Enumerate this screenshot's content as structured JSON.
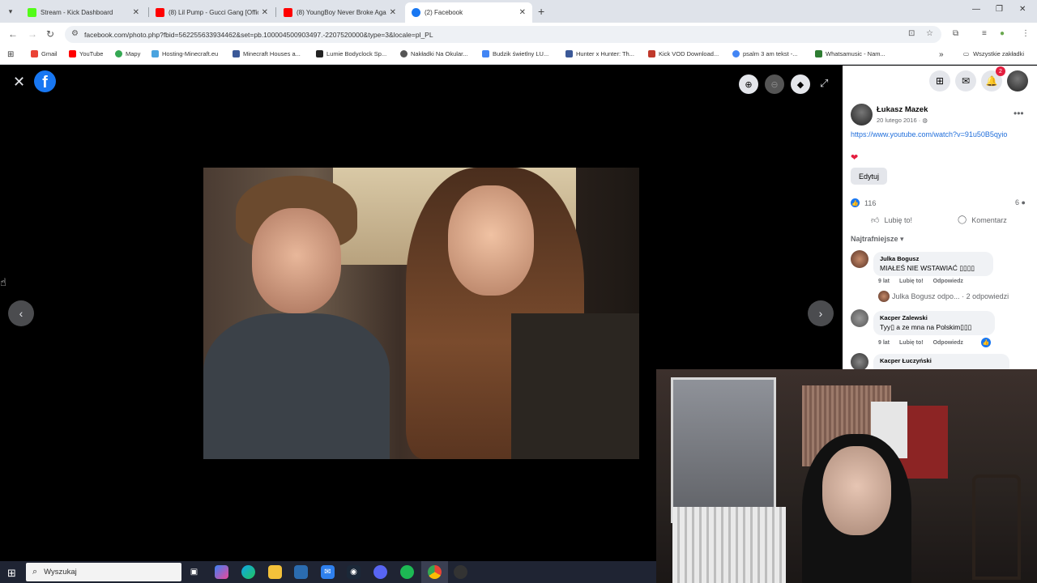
{
  "browser": {
    "tabs": [
      {
        "title": "Stream - Kick Dashboard",
        "color": "#53fc18"
      },
      {
        "title": "(8) Lil Pump - Gucci Gang [Offic",
        "color": "#ff0000"
      },
      {
        "title": "(8) YoungBoy Never Broke Aga",
        "color": "#ff0000"
      },
      {
        "title": "(2) Facebook",
        "color": "#1877f2"
      }
    ],
    "url": "facebook.com/photo.php?fbid=562255633934462&set=pb.100004500903497.-2207520000&type=3&locale=pl_PL",
    "bookmarks": [
      {
        "label": "Gmail",
        "color": "#ea4335"
      },
      {
        "label": "YouTube",
        "color": "#ff0000"
      },
      {
        "label": "Mapy",
        "color": "#34a853"
      },
      {
        "label": "Hosting-Minecraft.eu",
        "color": "#4aa3df"
      },
      {
        "label": "Minecraft Houses a...",
        "color": "#3b5998"
      },
      {
        "label": "Lumie Bodyclock Sp...",
        "color": "#222222"
      },
      {
        "label": "Nakładki Na Okular...",
        "color": "#555555"
      },
      {
        "label": "Budzik świetlny LU...",
        "color": "#4285f4"
      },
      {
        "label": "Hunter x Hunter: Th...",
        "color": "#3b5998"
      },
      {
        "label": "Kick VOD Download...",
        "color": "#c0392b"
      },
      {
        "label": "psalm 3 am tekst -...",
        "color": "#4285f4"
      },
      {
        "label": "Whatsamusic - Nam...",
        "color": "#2e7d32"
      }
    ],
    "all_bookmarks": "Wszystkie zakładki"
  },
  "post": {
    "author": "Łukasz Mazek",
    "date": "20 lutego 2016",
    "link": "https://www.youtube.com/watch?v=91u50B5qyio",
    "edit_label": "Edytuj",
    "likes": "116",
    "comments_count": "6",
    "like_label": "Lubię to!",
    "comment_label": "Komentarz",
    "sort_label": "Najtrafniejsze",
    "notifications": "2"
  },
  "comments": [
    {
      "name": "Julka Bogusz",
      "text": "MIAŁEŚ NIE WSTAWIAĆ ▯▯▯▯",
      "time": "9 lat",
      "like": "Lubię to!",
      "reply": "Odpowiedz"
    },
    {
      "name": "Kacper Zalewski",
      "text": "Tyy▯ a ze mna na Polskim▯▯▯",
      "time": "9 lat",
      "like": "Lubię to!",
      "reply": "Odpowiedz"
    },
    {
      "name": "Kacper Łuczyński",
      "text": ""
    }
  ],
  "reply_summary": {
    "who": "Julka Bogusz odpo...",
    "count": "· 2 odpowiedzi"
  },
  "taskbar": {
    "search_placeholder": "Wyszukaj"
  }
}
